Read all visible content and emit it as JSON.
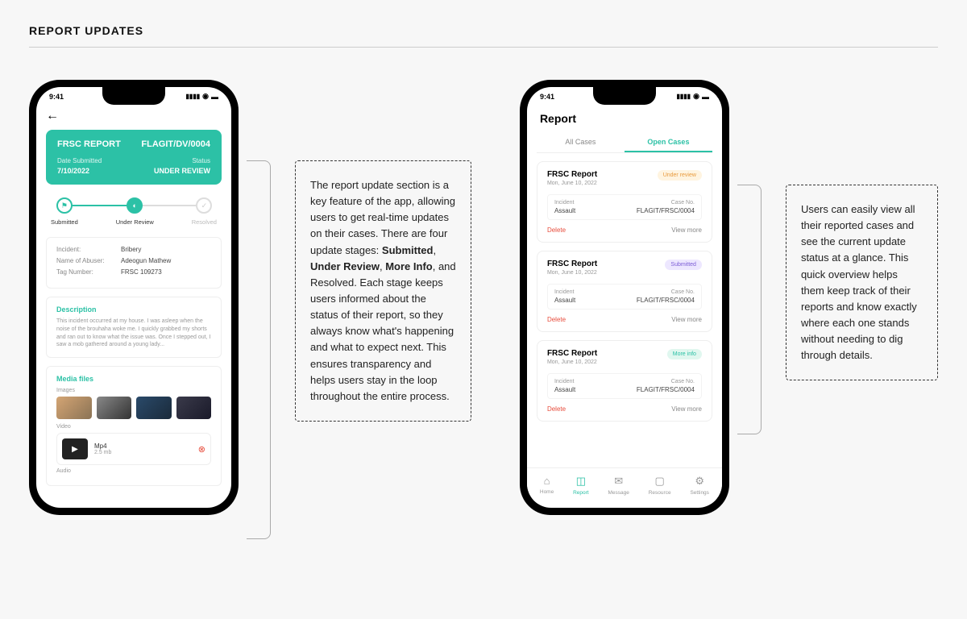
{
  "title": "REPORT UPDATES",
  "phone1": {
    "time": "9:41",
    "card": {
      "title": "FRSC REPORT",
      "id": "FLAGIT/DV/0004",
      "date_label": "Date Submitted",
      "date": "7/10/2022",
      "status_label": "Status",
      "status": "UNDER REVIEW"
    },
    "steps": {
      "s1": "Submitted",
      "s2": "Under Review",
      "s3": "Resolved"
    },
    "info": {
      "incident_l": "Incident:",
      "incident_v": "Bribery",
      "abuser_l": "Name of Abuser:",
      "abuser_v": "Adeogun Mathew",
      "tag_l": "Tag Number:",
      "tag_v": "FRSC 109273"
    },
    "desc": {
      "title": "Description",
      "text": "This incident occurred at my house. I was asleep when the noise of the brouhaha woke me. I quickly grabbed my shorts and ran out to know what the issue was. Once I stepped out, I saw a mob gathered around a young lady..."
    },
    "media": {
      "title": "Media files",
      "images_l": "Images",
      "video_l": "Video",
      "video_name": "Mp4",
      "video_size": "2.5 mb",
      "audio_l": "Audio"
    }
  },
  "callout1": {
    "text1": "The report update section is a key feature of the app, allowing users to get real-time updates on their cases. There are four update stages: ",
    "bold1": "Submitted",
    "bold2": "Under Review",
    "bold3": "More Info",
    "text2": ", and ",
    "bold4": "Resolved",
    "text3": ". Each stage keeps users informed about the status of their report, so they always know what's happening and what to expect next. This ensures transparency and helps users stay in the loop throughout the entire process."
  },
  "phone2": {
    "time": "9:41",
    "title": "Report",
    "tabs": {
      "t1": "All Cases",
      "t2": "Open Cases"
    },
    "cases": [
      {
        "name": "FRSC Report",
        "date": "Mon, June 10, 2022",
        "badge": "Under review",
        "badgeClass": "review",
        "incident_l": "Incident",
        "incident_v": "Assault",
        "case_l": "Case No.",
        "case_v": "FLAGIT/FRSC/0004",
        "del": "Delete",
        "vm": "View more"
      },
      {
        "name": "FRSC Report",
        "date": "Mon, June 10, 2022",
        "badge": "Submitted",
        "badgeClass": "submitted",
        "incident_l": "Incident",
        "incident_v": "Assault",
        "case_l": "Case No.",
        "case_v": "FLAGIT/FRSC/0004",
        "del": "Delete",
        "vm": "View more"
      },
      {
        "name": "FRSC Report",
        "date": "Mon, June 10, 2022",
        "badge": "More info",
        "badgeClass": "moreinfo",
        "incident_l": "Incident",
        "incident_v": "Assault",
        "case_l": "Case No.",
        "case_v": "FLAGIT/FRSC/0004",
        "del": "Delete",
        "vm": "View more"
      }
    ],
    "nav": {
      "home": "Home",
      "report": "Report",
      "message": "Message",
      "resource": "Resource",
      "settings": "Settings"
    }
  },
  "callout2": "Users can easily view all their reported cases and see the current update status at a glance. This quick overview helps them keep track of their reports and know exactly where each one stands without needing to dig through details."
}
